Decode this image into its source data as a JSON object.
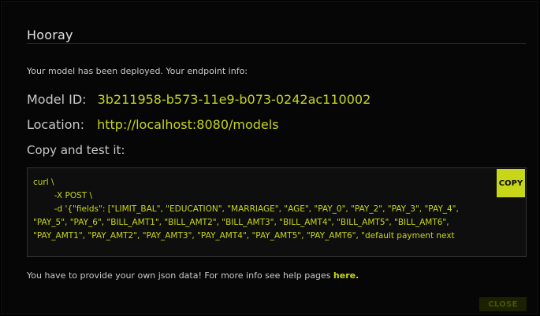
{
  "modal": {
    "title": "Hooray",
    "intro": "Your model has been deployed. Your endpoint info:",
    "model_id_label": "Model ID:",
    "model_id_value": "3b211958-b573-11e9-b073-0242ac110002",
    "location_label": "Location:",
    "location_value": "http://localhost:8080/models",
    "copy_title": "Copy and test it:",
    "code": "curl \\\n        -X POST \\\n        -d '{\"fields\": [\"LIMIT_BAL\", \"EDUCATION\", \"MARRIAGE\", \"AGE\", \"PAY_0\", \"PAY_2\", \"PAY_3\", \"PAY_4\", \"PAY_5\", \"PAY_6\", \"BILL_AMT1\", \"BILL_AMT2\", \"BILL_AMT3\", \"BILL_AMT4\", \"BILL_AMT5\", \"BILL_AMT6\", \"PAY_AMT1\", \"PAY_AMT2\", \"PAY_AMT3\", \"PAY_AMT4\", \"PAY_AMT5\", \"PAY_AMT6\", \"default payment next",
    "copy_button": "COPY",
    "help_text": "You have to provide your own json data! For more info see help pages ",
    "help_link": "here.",
    "close_button": "CLOSE"
  },
  "colors": {
    "accent": "#c8d61a",
    "background": "#060606",
    "text": "#c8c8c8"
  }
}
